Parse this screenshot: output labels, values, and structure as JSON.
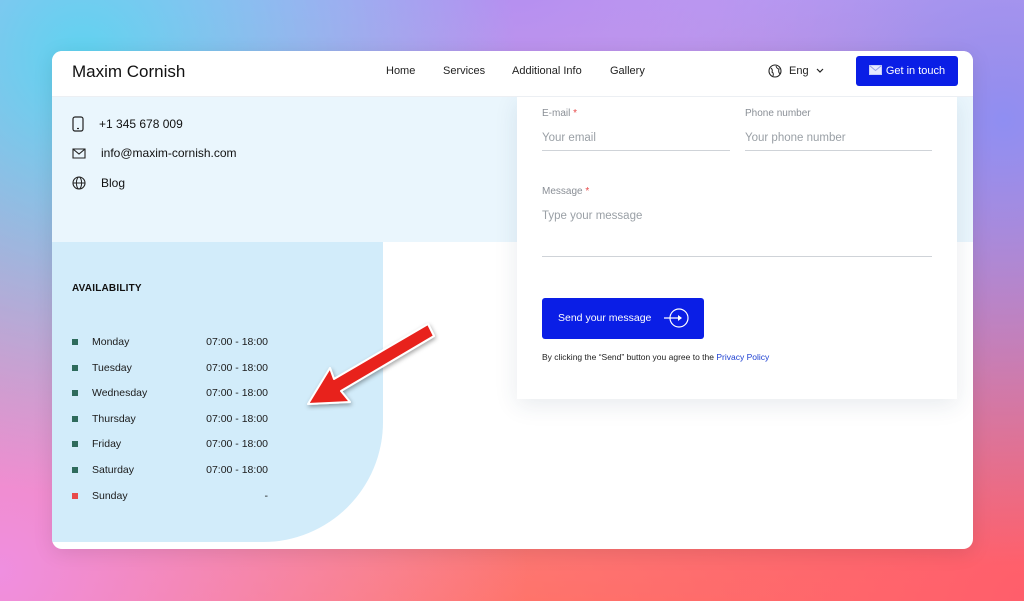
{
  "header": {
    "brand": "Maxim Cornish",
    "nav": [
      {
        "label": "Home"
      },
      {
        "label": "Services"
      },
      {
        "label": "Additional Info"
      },
      {
        "label": "Gallery"
      }
    ],
    "language": "Eng",
    "cta_label": "Get in touch"
  },
  "contact": {
    "phone": "+1 345 678 009",
    "email": "info@maxim-cornish.com",
    "blog": "Blog"
  },
  "availability": {
    "title": "AVAILABILITY",
    "days": [
      {
        "day": "Monday",
        "hours": "07:00 - 18:00",
        "status_color": "#2e6b5c"
      },
      {
        "day": "Tuesday",
        "hours": "07:00 - 18:00",
        "status_color": "#2e6b5c"
      },
      {
        "day": "Wednesday",
        "hours": "07:00 - 18:00",
        "status_color": "#2e6b5c"
      },
      {
        "day": "Thursday",
        "hours": "07:00 - 18:00",
        "status_color": "#2e6b5c"
      },
      {
        "day": "Friday",
        "hours": "07:00 - 18:00",
        "status_color": "#2e6b5c"
      },
      {
        "day": "Saturday",
        "hours": "07:00 - 18:00",
        "status_color": "#2e6b5c"
      },
      {
        "day": "Sunday",
        "hours": "-",
        "status_color": "#e84a4a"
      }
    ]
  },
  "form": {
    "email_label": "E-mail",
    "email_placeholder": "Your email",
    "phone_label": "Phone number",
    "phone_placeholder": "Your phone number",
    "message_label": "Message",
    "message_placeholder": "Type your message",
    "required_mark": "*",
    "send_label": "Send your message",
    "disclaimer_text": "By clicking the “Send” button you agree to the",
    "privacy_link": "Privacy Policy"
  },
  "colors": {
    "accent": "#0a1ee6",
    "available": "#2e6b5c",
    "unavailable": "#e84a4a",
    "annotation_arrow": "#e8201a"
  }
}
